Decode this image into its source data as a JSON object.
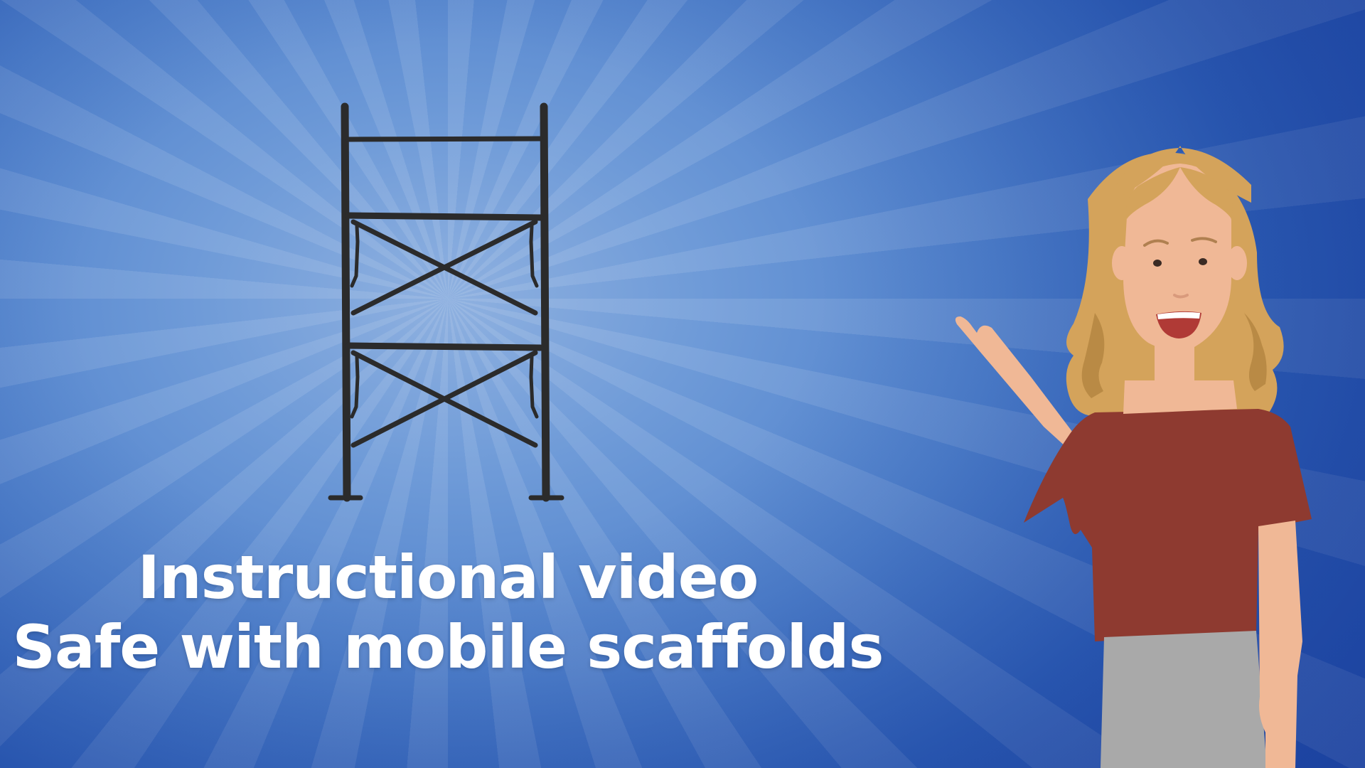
{
  "title": {
    "line1": "Instructional video",
    "line2": "Safe with mobile scaffolds"
  },
  "colors": {
    "background": "#3f73c6",
    "text": "#ffffff",
    "scaffold": "#2b2b2b",
    "hair": "#d4a35b",
    "skin": "#f0b896",
    "shirt": "#8e3a30",
    "skirt": "#a8a8a8"
  },
  "icons": {
    "scaffold": "mobile-scaffold-frame",
    "presenter": "female-presenter-character"
  }
}
